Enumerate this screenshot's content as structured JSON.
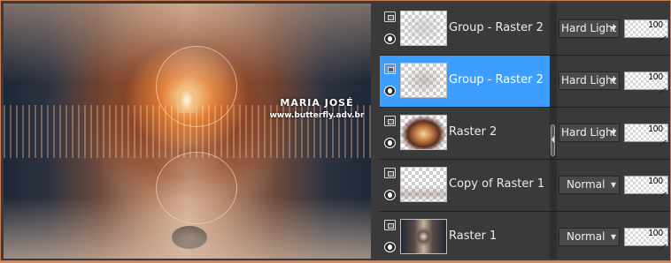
{
  "preview": {
    "watermark_name": "MARIA JOSÉ",
    "watermark_url": "www.butterfly.adv.br"
  },
  "layers": [
    {
      "name": "Group - Raster 2",
      "blend_mode": "Hard Light",
      "opacity": "100",
      "selected": false,
      "thumbnail": "group-raster-2-thumbnail"
    },
    {
      "name": "Group - Raster 2",
      "blend_mode": "Hard Light",
      "opacity": "100",
      "selected": true,
      "thumbnail": "group-raster-2-thumbnail"
    },
    {
      "name": "Raster 2",
      "blend_mode": "Hard Light",
      "opacity": "100",
      "selected": false,
      "thumbnail": "raster-2-thumbnail"
    },
    {
      "name": "Copy of Raster 1",
      "blend_mode": "Normal",
      "opacity": "100",
      "selected": false,
      "thumbnail": "copy-of-raster-1-thumbnail"
    },
    {
      "name": "Raster 1",
      "blend_mode": "Normal",
      "opacity": "100",
      "selected": false,
      "thumbnail": "raster-1-thumbnail"
    }
  ],
  "icons": {
    "link": "link-toggle-icon",
    "visibility": "eye-icon",
    "dropdown": "chevron-down-icon"
  },
  "colors": {
    "selection": "#3d9eff",
    "panel_bg": "#3a3a3a",
    "outer_border": "#d9865a"
  }
}
